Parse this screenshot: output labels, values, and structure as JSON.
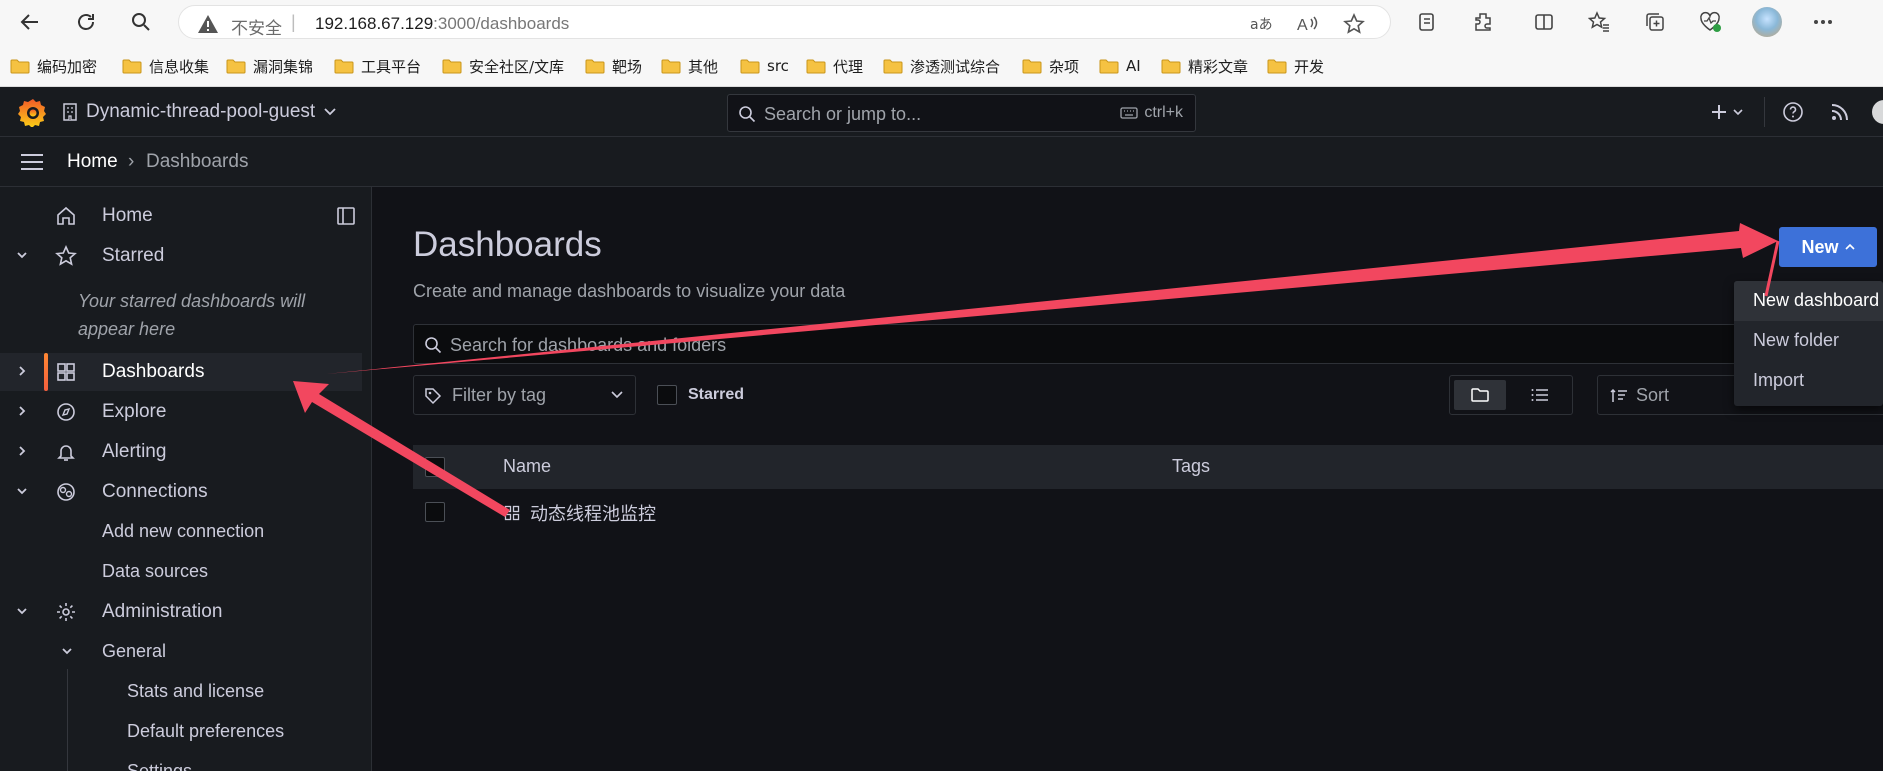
{
  "browser": {
    "insecure_label": "不安全",
    "separator": "|",
    "url_host": "192.168.67.129",
    "url_rest": ":3000/dashboards",
    "bookmarks": [
      "编码加密",
      "信息收集",
      "漏洞集锦",
      "工具平台",
      "安全社区/文库",
      "靶场",
      "其他",
      "src",
      "代理",
      "渗透测试综合",
      "杂项",
      "AI",
      "精彩文章",
      "开发"
    ]
  },
  "topbar": {
    "org_name": "Dynamic-thread-pool-guest",
    "search_placeholder": "Search or jump to...",
    "search_shortcut": "ctrl+k"
  },
  "breadcrumb": {
    "home": "Home",
    "separator": "›",
    "current": "Dashboards"
  },
  "sidebar": {
    "items": [
      {
        "label": "Home"
      },
      {
        "label": "Starred"
      },
      {
        "label": "Dashboards"
      },
      {
        "label": "Explore"
      },
      {
        "label": "Alerting"
      },
      {
        "label": "Connections"
      },
      {
        "label": "Administration"
      }
    ],
    "starred_empty": "Your starred dashboards will appear here",
    "connections_children": [
      "Add new connection",
      "Data sources"
    ],
    "admin_general": "General",
    "general_children": [
      "Stats and license",
      "Default preferences",
      "Settings"
    ]
  },
  "main": {
    "title": "Dashboards",
    "subtitle": "Create and manage dashboards to visualize your data",
    "search_placeholder": "Search for dashboards and folders",
    "filter_tag_placeholder": "Filter by tag",
    "starred_label": "Starred",
    "sort_placeholder": "Sort",
    "table": {
      "columns": [
        "Name",
        "Tags"
      ],
      "rows": [
        {
          "name": "动态线程池监控",
          "tags": ""
        }
      ]
    },
    "new_button": "New",
    "new_menu": [
      "New dashboard",
      "New folder",
      "Import"
    ]
  },
  "colors": {
    "accent_blue": "#3d71d9",
    "annotation_arrow": "#f2475f",
    "active_nav": "#ff8833"
  }
}
